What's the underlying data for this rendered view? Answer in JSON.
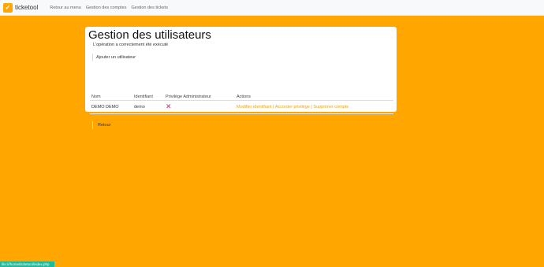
{
  "navbar": {
    "logo_glyph": "✓",
    "brand": "ticketool",
    "links": [
      "Retour au menu",
      "Gestion des comptes",
      "Gestion des tickets"
    ]
  },
  "page": {
    "title": "Gestion des utilisateurs",
    "success_message": "L'opération a correctement été exécuté",
    "add_button": "Ajouter un utilisateur",
    "back_button": "Retour"
  },
  "table": {
    "headers": [
      "Nom",
      "Identifiant",
      "Privilège Administrateur",
      "Actions"
    ],
    "rows": [
      {
        "name": "DEMO DEMO",
        "login": "demo",
        "admin": "✕",
        "actions": [
          "Modifier identifiant",
          "Accorder privilège",
          "Supprimer compte"
        ]
      }
    ]
  },
  "status_bar": {
    "text": "file:///home/ticketool/index.php"
  },
  "colors": {
    "background": "#ffa600",
    "link": "#e8a317",
    "cross": "#e0245e",
    "status": "#1abc9c"
  }
}
